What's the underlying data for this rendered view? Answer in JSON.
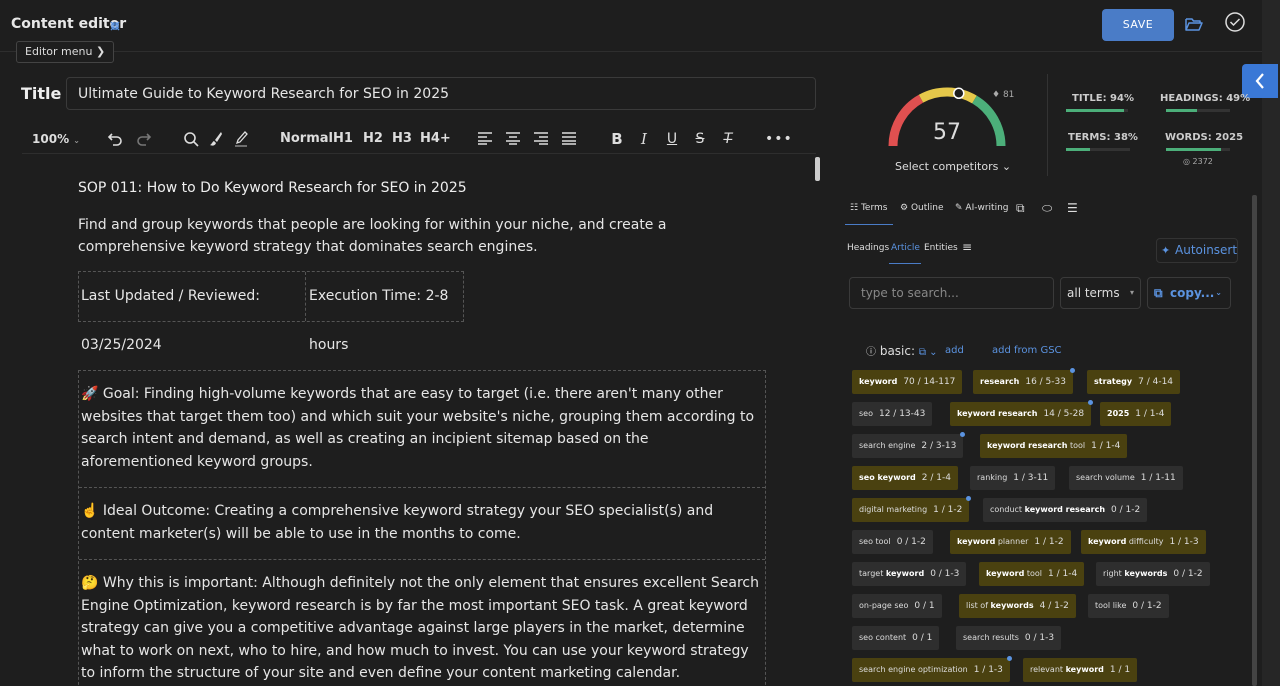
{
  "header": {
    "title": "Content editor",
    "editor_menu": "Editor menu",
    "save": "SAVE"
  },
  "title_field": {
    "label": "Title",
    "value": "Ultimate Guide to Keyword Research for SEO in 2025"
  },
  "toolbar": {
    "zoom": "100%",
    "normal": "Normal",
    "h1": "H1",
    "h2": "H2",
    "h3": "H3",
    "h4": "H4+"
  },
  "document": {
    "heading": "SOP 011: How to Do Keyword Research for SEO in 2025",
    "intro": "Find and group keywords that people are looking for within your niche, and create a comprehensive keyword strategy that dominates search engines.",
    "meta": {
      "updated": "Last Updated / Reviewed: 03/25/2024",
      "exec": "Execution Time: 2-8 hours"
    },
    "goal": "🚀 Goal: Finding high-volume keywords that are easy to target (i.e. there aren't many other websites that target them too) and which suit your website's niche, grouping them according to search intent and demand, as well as creating an incipient sitemap based on the aforementioned keyword groups.",
    "outcome": "☝️ Ideal Outcome: Creating a comprehensive keyword strategy your SEO specialist(s) and content marketer(s) will be able to use in the months to come.",
    "why": "🤔 Why this is important: Although definitely not the only element that ensures excellent Search Engine Optimization, keyword research is by far the most important SEO task. A great keyword strategy can give you a competitive advantage against large players in the market, determine what to work on next, who to hire, and how much to invest. You can use your keyword strategy to inform the structure of your site and even define your content marketing calendar."
  },
  "score": {
    "value": "57",
    "top_value": "81",
    "fraction": 0.57,
    "select_competitors": "Select competitors"
  },
  "stats": {
    "title": {
      "label": "TITLE: 94%",
      "fraction": 0.94
    },
    "headings": {
      "label": "HEADINGS: 49%",
      "fraction": 0.49
    },
    "terms": {
      "label": "TERMS: 38%",
      "fraction": 0.38
    },
    "words": {
      "label": "WORDS: 2025",
      "fraction": 0.86
    },
    "words_target": "2372"
  },
  "panel": {
    "tabs": [
      "Terms",
      "Outline",
      "AI-writing"
    ],
    "subtabs": [
      "Headings",
      "Article",
      "Entities"
    ],
    "autoinsert": "Autoinsert",
    "search_placeholder": "type to search...",
    "filter": "all terms",
    "copy": "copy...",
    "basic": "basic:",
    "add": "add",
    "add_gsc": "add from GSC"
  },
  "colors": {
    "accent": "#4a7cc7",
    "highlight_chip": "#4a4110",
    "gauge_green": "#4caf7a",
    "gauge_yellow": "#e5c84a",
    "gauge_red": "#e05050"
  },
  "terms": [
    {
      "pre": "",
      "kw": "keyword",
      "post": "",
      "count": "70 / 14-117",
      "hi": true,
      "dot": false
    },
    {
      "pre": "",
      "kw": "research",
      "post": "",
      "count": "16 / 5-33",
      "hi": true,
      "dot": true
    },
    {
      "pre": "",
      "kw": "strategy",
      "post": "",
      "count": "7 / 4-14",
      "hi": true,
      "dot": false
    },
    {
      "pre": "seo",
      "kw": "",
      "post": "",
      "count": "12 / 13-43",
      "hi": false,
      "dot": false
    },
    {
      "pre": "",
      "kw": "keyword research",
      "post": "",
      "count": "14 / 5-28",
      "hi": true,
      "dot": true
    },
    {
      "pre": "",
      "kw": "2025",
      "post": "",
      "count": "1 / 1-4",
      "hi": true,
      "dot": false
    },
    {
      "pre": "search engine",
      "kw": "",
      "post": "",
      "count": "2 / 3-13",
      "hi": false,
      "dot": true
    },
    {
      "pre": "",
      "kw": "keyword research",
      "post": " tool",
      "count": "1 / 1-4",
      "hi": true,
      "dot": false
    },
    {
      "pre": "",
      "kw": "seo keyword",
      "post": "",
      "count": "2 / 1-4",
      "hi": true,
      "dot": false
    },
    {
      "pre": "ranking",
      "kw": "",
      "post": "",
      "count": "1 / 3-11",
      "hi": false,
      "dot": false
    },
    {
      "pre": "search volume",
      "kw": "",
      "post": "",
      "count": "1 / 1-11",
      "hi": false,
      "dot": false
    },
    {
      "pre": "digital marketing",
      "kw": "",
      "post": "",
      "count": "1 / 1-2",
      "hi": true,
      "dot": true
    },
    {
      "pre": "conduct ",
      "kw": "keyword research",
      "post": "",
      "count": "0 / 1-2",
      "hi": false,
      "dot": false
    },
    {
      "pre": "seo tool",
      "kw": "",
      "post": "",
      "count": "0 / 1-2",
      "hi": false,
      "dot": false
    },
    {
      "pre": "",
      "kw": "keyword",
      "post": " planner",
      "count": "1 / 1-2",
      "hi": true,
      "dot": false
    },
    {
      "pre": "",
      "kw": "keyword",
      "post": " difficulty",
      "count": "1 / 1-3",
      "hi": true,
      "dot": false
    },
    {
      "pre": "target ",
      "kw": "keyword",
      "post": "",
      "count": "0 / 1-3",
      "hi": false,
      "dot": false
    },
    {
      "pre": "",
      "kw": "keyword",
      "post": " tool",
      "count": "1 / 1-4",
      "hi": true,
      "dot": false
    },
    {
      "pre": "right ",
      "kw": "keywords",
      "post": "",
      "count": "0 / 1-2",
      "hi": false,
      "dot": false
    },
    {
      "pre": "on-page seo",
      "kw": "",
      "post": "",
      "count": "0 / 1",
      "hi": false,
      "dot": false
    },
    {
      "pre": "list of ",
      "kw": "keywords",
      "post": "",
      "count": "4 / 1-2",
      "hi": true,
      "dot": false
    },
    {
      "pre": "tool like",
      "kw": "",
      "post": "",
      "count": "0 / 1-2",
      "hi": false,
      "dot": false
    },
    {
      "pre": "seo content",
      "kw": "",
      "post": "",
      "count": "0 / 1",
      "hi": false,
      "dot": false
    },
    {
      "pre": "search results",
      "kw": "",
      "post": "",
      "count": "0 / 1-3",
      "hi": false,
      "dot": false
    },
    {
      "pre": "search engine optimization",
      "kw": "",
      "post": "",
      "count": "1 / 1-3",
      "hi": true,
      "dot": true
    },
    {
      "pre": "relevant ",
      "kw": "keyword",
      "post": "",
      "count": "1 / 1",
      "hi": true,
      "dot": false
    }
  ]
}
